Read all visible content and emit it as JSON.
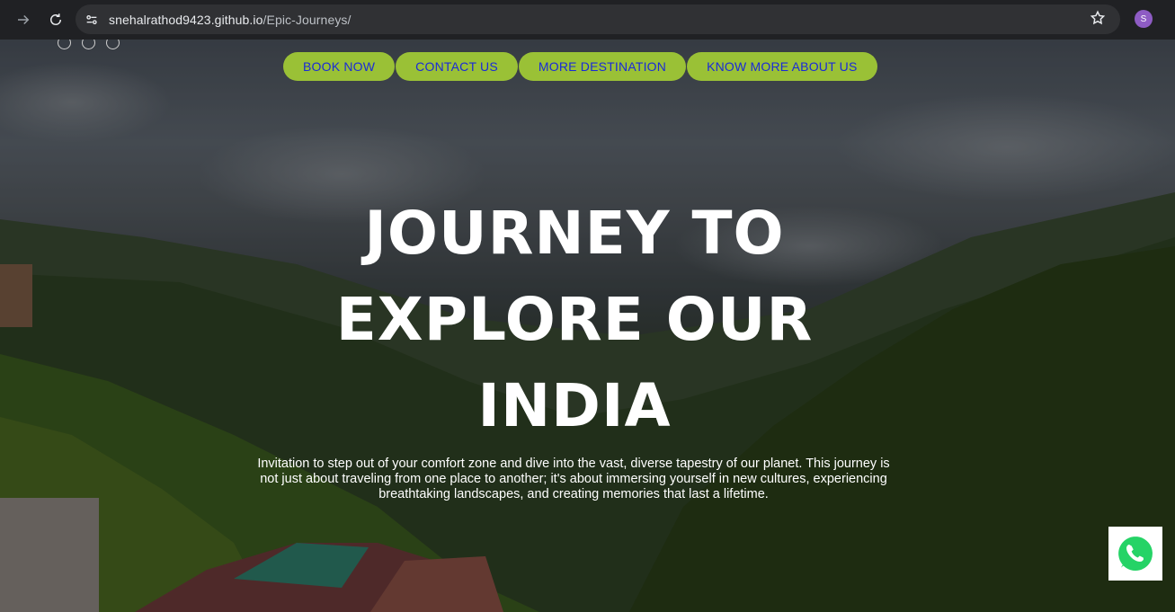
{
  "browser": {
    "url_host": "snehalrathod9423.github.io",
    "url_path": "/Epic-Journeys/",
    "profile_initial": "S",
    "icons": [
      "forward-arrow-icon",
      "reload-icon",
      "site-settings-icon",
      "bookmark-star-icon"
    ]
  },
  "nav": {
    "buttons": [
      "BOOK NOW",
      "CONTACT US",
      "MORE DESTINATION",
      "KNOW MORE ABOUT US"
    ]
  },
  "hero": {
    "title_lines": [
      "JOURNEY TO",
      "EXPLORE OUR",
      "INDIA"
    ],
    "description": "Invitation to step out of your comfort zone and dive into the vast, diverse tapestry of our planet. This journey is not just about traveling from one place to another; it's about immersing yourself in new cultures, experiencing breathtaking landscapes, and creating memories that last a lifetime."
  },
  "colors": {
    "button_bg": "#9ac136",
    "button_text": "#1a2ad8",
    "whatsapp_green": "#25d366"
  }
}
